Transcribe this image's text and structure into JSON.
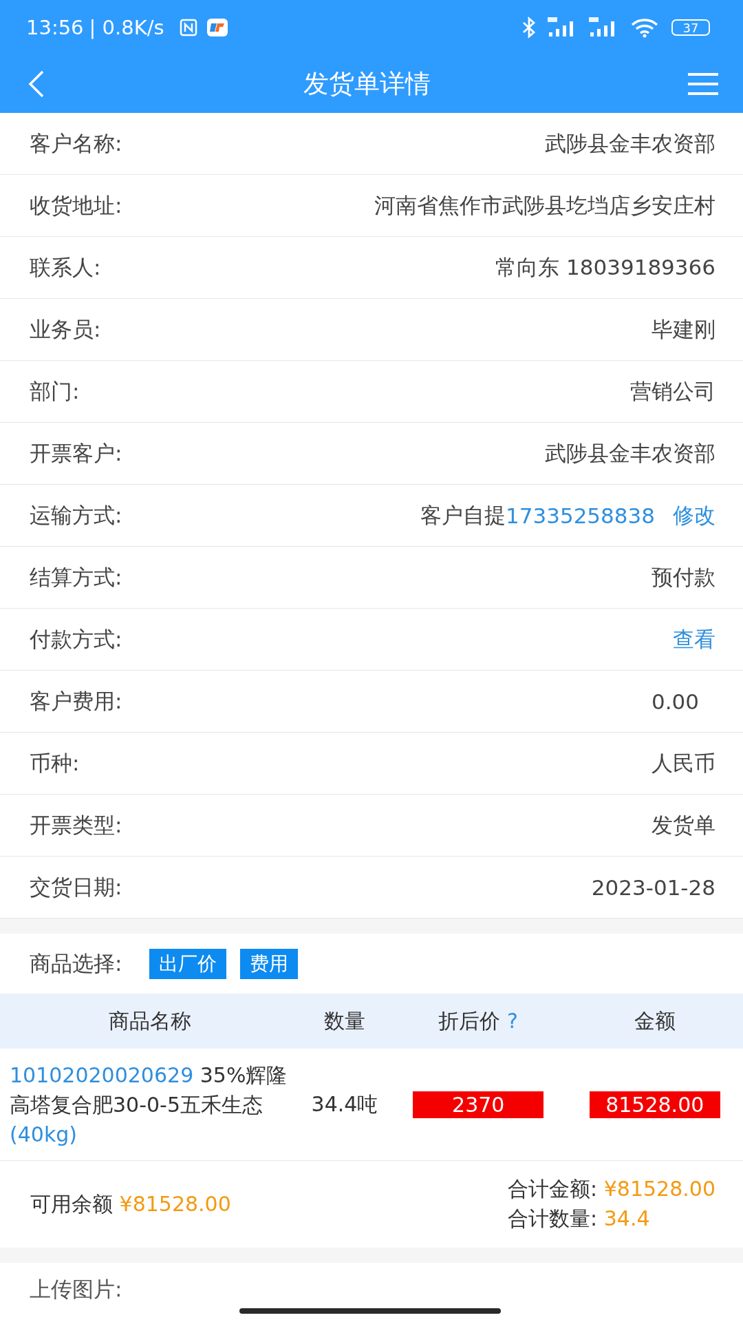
{
  "status_bar": {
    "time": "13:56",
    "speed": "| 0.8K/s",
    "battery": "37"
  },
  "title_bar": {
    "title": "发货单详情"
  },
  "fields": [
    {
      "label": "客户名称:",
      "parts": [
        {
          "kind": "text",
          "text": "武陟县金丰农资部"
        }
      ]
    },
    {
      "label": "收货地址:",
      "parts": [
        {
          "kind": "text",
          "text": "河南省焦作市武陟县圪垱店乡安庄村"
        }
      ]
    },
    {
      "label": "联系人:",
      "parts": [
        {
          "kind": "text",
          "text": "常向东 18039189366"
        }
      ]
    },
    {
      "label": "业务员:",
      "parts": [
        {
          "kind": "text",
          "text": "毕建刚"
        }
      ]
    },
    {
      "label": "部门:",
      "parts": [
        {
          "kind": "text",
          "text": "营销公司"
        }
      ]
    },
    {
      "label": "开票客户:",
      "parts": [
        {
          "kind": "text",
          "text": "武陟县金丰农资部"
        }
      ]
    },
    {
      "label": "运输方式:",
      "parts": [
        {
          "kind": "text",
          "text": "客户自提"
        },
        {
          "kind": "phone",
          "text": "17335258838"
        },
        {
          "kind": "link",
          "text": "修改"
        }
      ]
    },
    {
      "label": "结算方式:",
      "parts": [
        {
          "kind": "text",
          "text": "预付款"
        }
      ]
    },
    {
      "label": "付款方式:",
      "parts": [
        {
          "kind": "link",
          "text": "查看"
        }
      ]
    },
    {
      "label": "客户费用:",
      "parts": [
        {
          "kind": "amount",
          "text": "0.00"
        }
      ]
    },
    {
      "label": "币种:",
      "parts": [
        {
          "kind": "text",
          "text": "人民币"
        }
      ]
    },
    {
      "label": "开票类型:",
      "parts": [
        {
          "kind": "text",
          "text": "发货单"
        }
      ]
    },
    {
      "label": "交货日期:",
      "parts": [
        {
          "kind": "text",
          "text": "2023-01-28"
        }
      ]
    }
  ],
  "product_select": {
    "label": "商品选择:",
    "buttons": [
      "出厂价",
      "费用"
    ]
  },
  "table": {
    "columns": [
      "商品名称",
      "数量",
      "折后价",
      "金额"
    ],
    "help_mark": "?",
    "rows": [
      {
        "code": "10102020020629",
        "name": "35%辉隆高塔复合肥30-0-5五禾生态",
        "spec": "(40kg)",
        "quantity": "34.4吨",
        "price": "2370",
        "amount": "81528.00"
      }
    ]
  },
  "summary": {
    "balance_label": "可用余额",
    "balance": "¥81528.00",
    "total_amount_label": "合计金额:",
    "total_amount": "¥81528.00",
    "total_qty_label": "合计数量:",
    "total_qty": "34.4"
  },
  "upload": {
    "label": "上传图片:"
  }
}
